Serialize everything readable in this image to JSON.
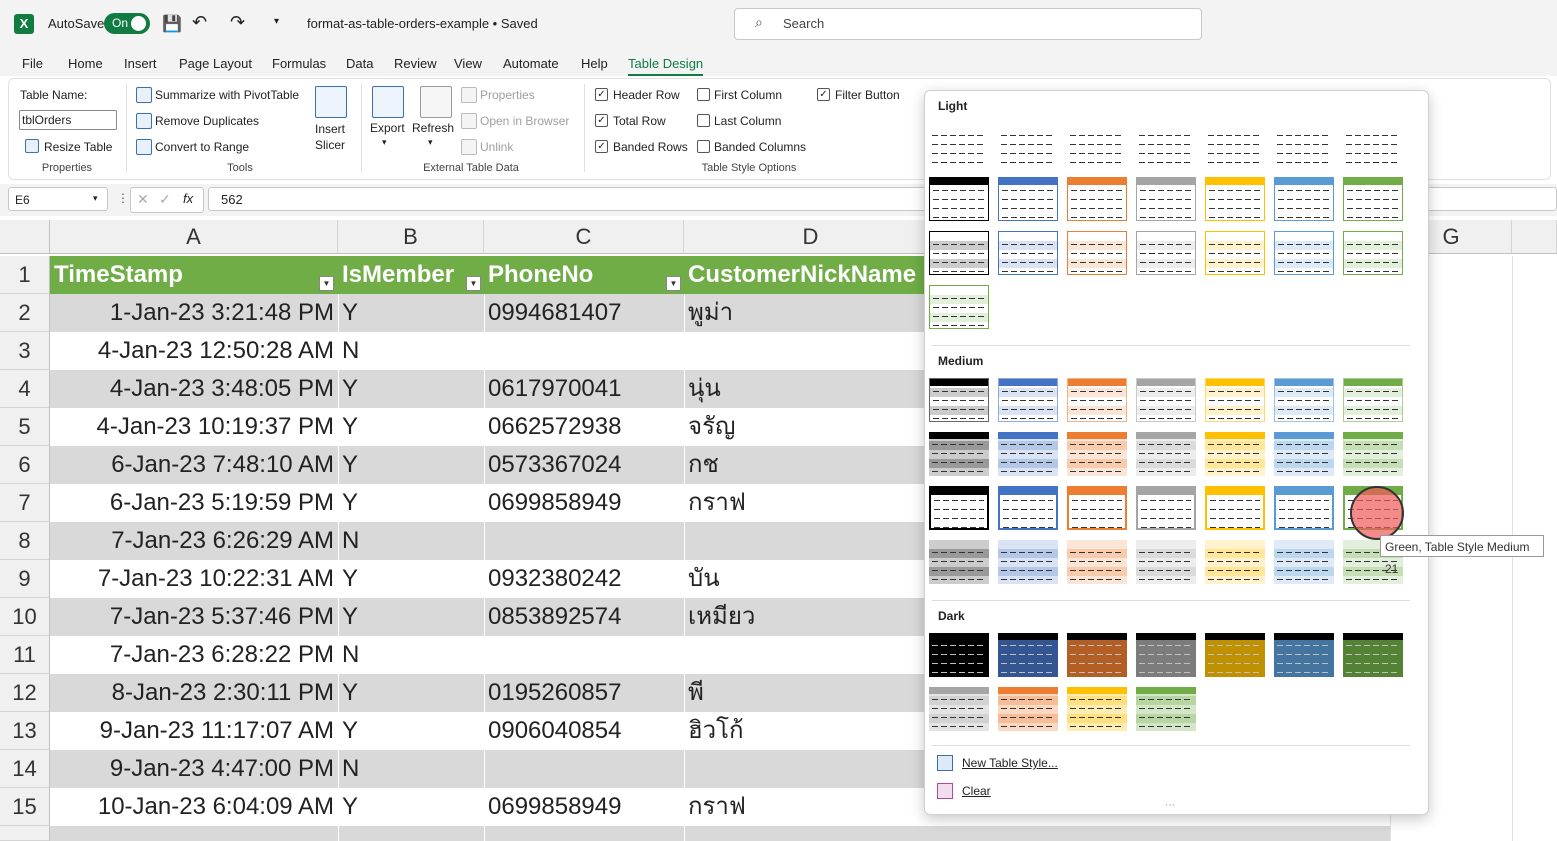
{
  "titlebar": {
    "app_icon": "X",
    "autosave_label": "AutoSave",
    "autosave_state": "On",
    "filename": "format-as-table-orders-example • Saved",
    "search_placeholder": "Search"
  },
  "tabs": [
    {
      "label": "File"
    },
    {
      "label": "Home"
    },
    {
      "label": "Insert"
    },
    {
      "label": "Page Layout"
    },
    {
      "label": "Formulas"
    },
    {
      "label": "Data"
    },
    {
      "label": "Review"
    },
    {
      "label": "View"
    },
    {
      "label": "Automate"
    },
    {
      "label": "Help"
    },
    {
      "label": "Table Design",
      "active": true
    }
  ],
  "ribbon": {
    "properties": {
      "table_name_label": "Table Name:",
      "table_name_value": "tblOrders",
      "resize": "Resize Table",
      "group": "Properties"
    },
    "tools": {
      "summarize": "Summarize with PivotTable",
      "remove_dup": "Remove Duplicates",
      "convert": "Convert to Range",
      "insert_slicer": "Insert Slicer",
      "group": "Tools"
    },
    "external": {
      "export": "Export",
      "refresh": "Refresh",
      "properties": "Properties",
      "open_browser": "Open in Browser",
      "unlink": "Unlink",
      "group": "External Table Data"
    },
    "options": {
      "header_row": "Header Row",
      "total_row": "Total Row",
      "banded_rows": "Banded Rows",
      "first_column": "First Column",
      "last_column": "Last Column",
      "banded_columns": "Banded Columns",
      "filter_button": "Filter Button",
      "group": "Table Style Options"
    }
  },
  "formula_bar": {
    "name_box": "E6",
    "fx": "fx",
    "value": "562"
  },
  "columns": [
    "A",
    "B",
    "C",
    "D",
    "G"
  ],
  "headers": [
    "TimeStamp",
    "IsMember",
    "PhoneNo",
    "CustomerNickName"
  ],
  "rows": [
    {
      "n": "1"
    },
    {
      "n": "2",
      "a": "1-Jan-23 3:21:48 PM",
      "b": "Y",
      "c": "0994681407",
      "d": "พูม่า"
    },
    {
      "n": "3",
      "a": "4-Jan-23 12:50:28 AM",
      "b": "N",
      "c": "",
      "d": ""
    },
    {
      "n": "4",
      "a": "4-Jan-23 3:48:05 PM",
      "b": "Y",
      "c": "0617970041",
      "d": "นุ่น"
    },
    {
      "n": "5",
      "a": "4-Jan-23 10:19:37 PM",
      "b": "Y",
      "c": "0662572938",
      "d": "จรัญ"
    },
    {
      "n": "6",
      "a": "6-Jan-23 7:48:10 AM",
      "b": "Y",
      "c": "0573367024",
      "d": "กช"
    },
    {
      "n": "7",
      "a": "6-Jan-23 5:19:59 PM",
      "b": "Y",
      "c": "0699858949",
      "d": "กราฟ"
    },
    {
      "n": "8",
      "a": "7-Jan-23 6:26:29 AM",
      "b": "N",
      "c": "",
      "d": ""
    },
    {
      "n": "9",
      "a": "7-Jan-23 10:22:31 AM",
      "b": "Y",
      "c": "0932380242",
      "d": "บัน"
    },
    {
      "n": "10",
      "a": "7-Jan-23 5:37:46 PM",
      "b": "Y",
      "c": "0853892574",
      "d": "เหมียว"
    },
    {
      "n": "11",
      "a": "7-Jan-23 6:28:22 PM",
      "b": "N",
      "c": "",
      "d": ""
    },
    {
      "n": "12",
      "a": "8-Jan-23 2:30:11 PM",
      "b": "Y",
      "c": "0195260857",
      "d": "พี"
    },
    {
      "n": "13",
      "a": "9-Jan-23 11:17:07 AM",
      "b": "Y",
      "c": "0906040854",
      "d": "ฮิวโก้"
    },
    {
      "n": "14",
      "a": "9-Jan-23 4:47:00 PM",
      "b": "N",
      "c": "",
      "d": ""
    },
    {
      "n": "15",
      "a": "10-Jan-23 6:04:09 AM",
      "b": "Y",
      "c": "0699858949",
      "d": "กราฟ"
    }
  ],
  "gallery": {
    "light": "Light",
    "medium": "Medium",
    "dark": "Dark",
    "new_style": "New Table Style...",
    "clear": "Clear",
    "tooltip": "Green, Table Style Medium 21",
    "colors": [
      "#000000",
      "#4472c4",
      "#ed7d31",
      "#a5a5a5",
      "#ffc000",
      "#5b9bd5",
      "#70ad47"
    ]
  }
}
